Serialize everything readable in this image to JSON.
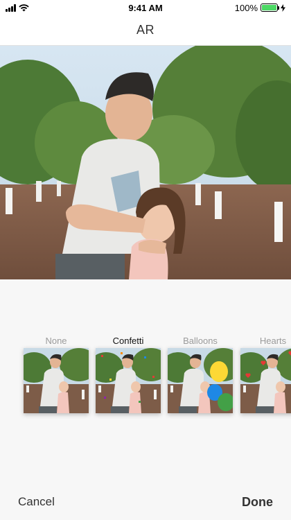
{
  "status_bar": {
    "time": "9:41 AM",
    "battery_percent": "100%",
    "battery_level": 1.0,
    "icons": [
      "signal-icon",
      "wifi-icon",
      "battery-icon",
      "charging-icon"
    ]
  },
  "nav": {
    "title": "AR"
  },
  "effects": {
    "items": [
      {
        "label": "None",
        "selected": false
      },
      {
        "label": "Confetti",
        "selected": true
      },
      {
        "label": "Balloons",
        "selected": false
      },
      {
        "label": "Hearts",
        "selected": false
      }
    ]
  },
  "toolbar": {
    "cancel_label": "Cancel",
    "done_label": "Done"
  },
  "colors": {
    "battery": "#4cd964",
    "selected_label": "#111111",
    "unselected_label": "#9a9a9a"
  }
}
